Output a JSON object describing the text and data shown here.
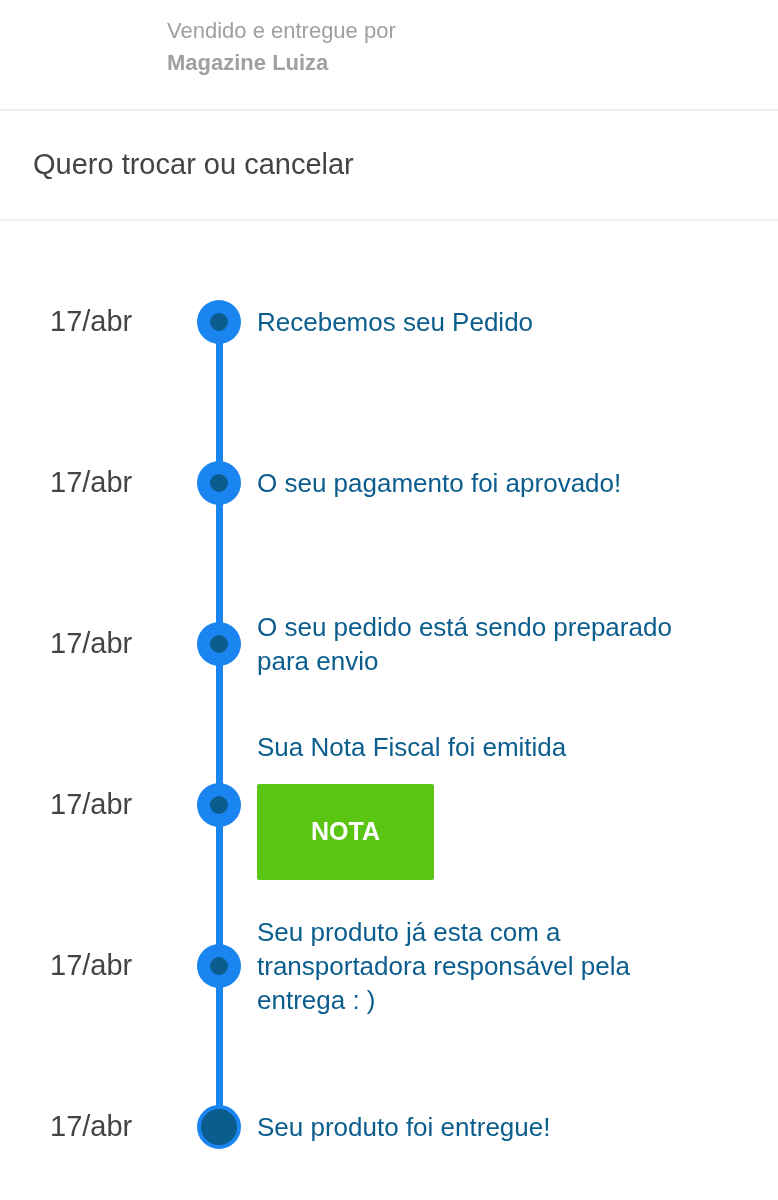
{
  "seller": {
    "label": "Vendido e entregue por",
    "name": "Magazine Luiza"
  },
  "exchange_link": "Quero trocar ou cancelar",
  "timeline": [
    {
      "date": "17/abr",
      "text": "Recebemos seu Pedido",
      "current": false
    },
    {
      "date": "17/abr",
      "text": "O seu pagamento foi aprovado!",
      "current": false
    },
    {
      "date": "17/abr",
      "text": "O seu pedido está sendo preparado para envio",
      "current": false
    },
    {
      "date": "17/abr",
      "text": "Sua Nota Fiscal foi emitida",
      "button": "NOTA",
      "current": false
    },
    {
      "date": "17/abr",
      "text": "Seu produto já esta com a transportadora responsável pela entrega : )",
      "current": false
    },
    {
      "date": "17/abr",
      "text": "Seu produto foi entregue!",
      "current": true
    }
  ]
}
